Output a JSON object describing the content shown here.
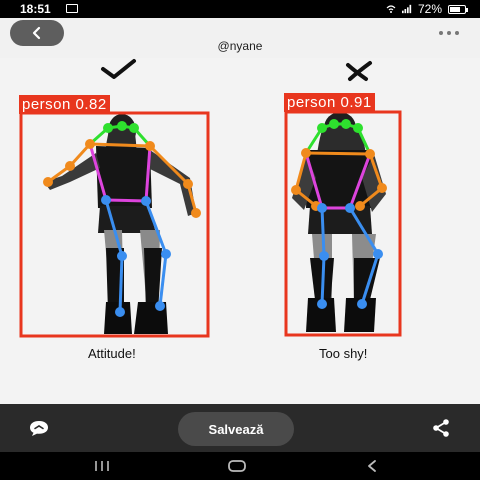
{
  "status_bar": {
    "time": "18:51",
    "battery": "72%",
    "battery_level": 0.72
  },
  "header": {
    "username": "@nyane",
    "back_icon": "chevron-left-icon",
    "more_icon": "more-horizontal-icon"
  },
  "image": {
    "left": {
      "mark": "✓",
      "detection_label": "person 0.82",
      "caption": "Attitude!"
    },
    "right": {
      "mark": "✗",
      "detection_label": "person 0.91",
      "caption": "Too shy!"
    },
    "colors": {
      "box": "#e8361e",
      "head": "#2ee02e",
      "arms": "#f08a1c",
      "torso": "#dd44dd",
      "legs": "#3a8ef0"
    }
  },
  "toolbar": {
    "save_label": "Salvează",
    "comment_icon": "comment-icon",
    "share_icon": "share-icon"
  },
  "nav": {
    "recent_icon": "recent-apps-icon",
    "home_icon": "home-icon",
    "back_icon": "back-icon"
  }
}
